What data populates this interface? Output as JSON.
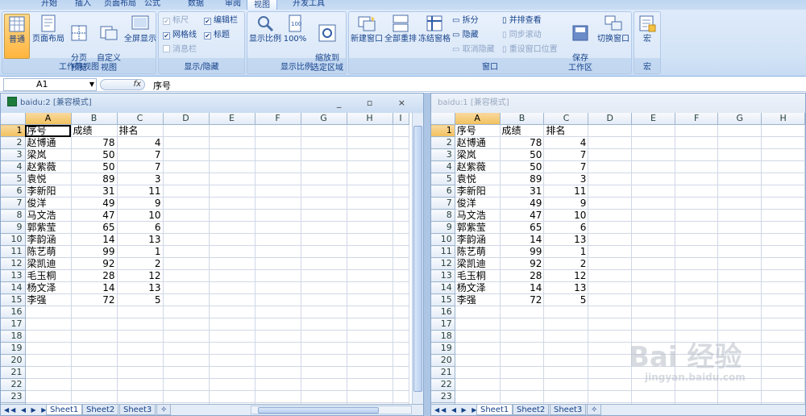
{
  "ribbon_tabs": [
    "开始",
    "插入",
    "页面布局",
    "公式",
    "数据",
    "审阅",
    "视图",
    "开发工具"
  ],
  "active_tab": "视图",
  "groups": {
    "workbook_views": {
      "label": "工作簿视图",
      "buttons": [
        "普通",
        "页面布局",
        "分页\n预览",
        "自定义\n视图",
        "全屏显示"
      ]
    },
    "show_hide": {
      "label": "显示/隐藏",
      "items": [
        {
          "label": "标尺",
          "checked": true,
          "disabled": true
        },
        {
          "label": "编辑栏",
          "checked": true,
          "disabled": false
        },
        {
          "label": "网格线",
          "checked": true,
          "disabled": false
        },
        {
          "label": "标题",
          "checked": true,
          "disabled": false
        },
        {
          "label": "消息栏",
          "checked": false,
          "disabled": true
        }
      ]
    },
    "zoom": {
      "label": "显示比例",
      "buttons": [
        "显示比例",
        "100%",
        "缩放到\n选定区域"
      ]
    },
    "window": {
      "label": "窗口",
      "big_buttons": [
        "新建窗口",
        "全部重排",
        "冻结窗格"
      ],
      "small_left": [
        "拆分",
        "隐藏",
        "取消隐藏"
      ],
      "small_right": [
        "并排查看",
        "同步滚动",
        "重设窗口位置"
      ],
      "save_buttons": [
        "保存\n工作区",
        "切换窗口"
      ]
    },
    "macro": {
      "label": "宏",
      "buttons": [
        "宏"
      ]
    }
  },
  "formula_bar": {
    "name_box": "A1",
    "fx": "fx",
    "content": "序号"
  },
  "window_left": {
    "title": "baidu:2  [兼容模式]"
  },
  "window_right": {
    "title": "baidu:1  [兼容模式]"
  },
  "columns_left": [
    "A",
    "B",
    "C",
    "D",
    "E",
    "F",
    "G",
    "H",
    "I"
  ],
  "columns_right": [
    "A",
    "B",
    "C",
    "D",
    "E",
    "F",
    "G",
    "H"
  ],
  "headers": [
    "序号",
    "成绩",
    "排名"
  ],
  "rows": [
    [
      "赵博通",
      "78",
      "4"
    ],
    [
      "梁岚",
      "50",
      "7"
    ],
    [
      "赵紫薇",
      "50",
      "7"
    ],
    [
      "袁悦",
      "89",
      "3"
    ],
    [
      "李新阳",
      "31",
      "11"
    ],
    [
      "俊洋",
      "49",
      "9"
    ],
    [
      "马文浩",
      "47",
      "10"
    ],
    [
      "郭紫莹",
      "65",
      "6"
    ],
    [
      "李韵涵",
      "14",
      "13"
    ],
    [
      "陈艺萌",
      "99",
      "1"
    ],
    [
      "梁凯迪",
      "92",
      "2"
    ],
    [
      "毛玉桐",
      "28",
      "12"
    ],
    [
      "杨文泽",
      "14",
      "13"
    ],
    [
      "李强",
      "72",
      "5"
    ]
  ],
  "total_rows": 24,
  "sheet_tabs": [
    "Sheet1",
    "Sheet2",
    "Sheet3"
  ],
  "watermark": {
    "text": "Bai 经验",
    "url": "jingyan.baidu.com"
  }
}
